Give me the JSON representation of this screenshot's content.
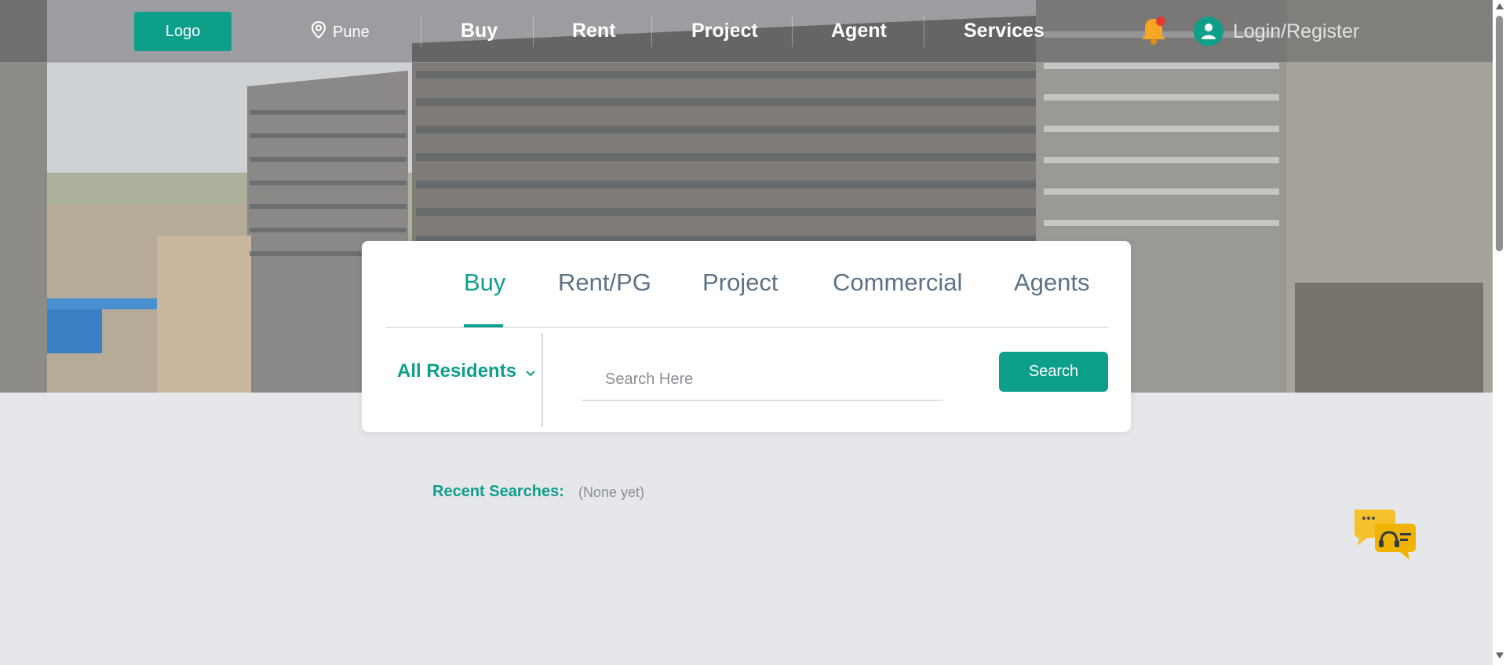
{
  "header": {
    "logo_label": "Logo",
    "location": "Pune",
    "nav": [
      "Buy",
      "Rent",
      "Project",
      "Agent",
      "Services"
    ],
    "login_label": "Login/Register"
  },
  "search_card": {
    "tabs": [
      "Buy",
      "Rent/PG",
      "Project",
      "Commercial",
      "Agents"
    ],
    "active_tab": "Buy",
    "resident_filter": "All Residents",
    "search_placeholder": "Search Here",
    "search_button": "Search"
  },
  "recent": {
    "label": "Recent Searches:",
    "value": "(None yet)"
  },
  "colors": {
    "accent": "#0e9f8a",
    "tab_inactive": "#5d7285",
    "page_bg": "#e6e7ea",
    "notification_dot": "#e53935",
    "bell": "#f5a623",
    "chat_bubble": "#f6c12b"
  },
  "icons": {
    "location": "map-pin-icon",
    "notification": "bell-icon",
    "user": "user-icon",
    "dropdown": "chevron-down-icon",
    "chat": "chat-support-icon"
  }
}
